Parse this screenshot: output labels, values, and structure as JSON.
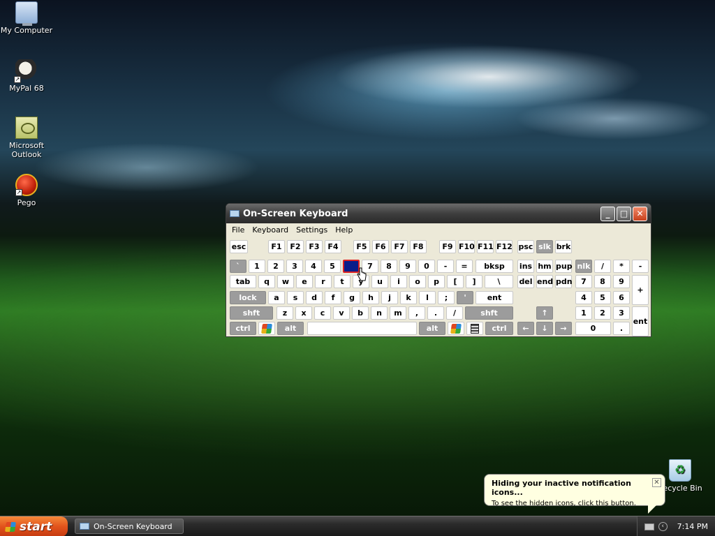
{
  "desktop_icons": [
    {
      "name": "My Computer",
      "icon": "computer-icon"
    },
    {
      "name": "MyPal 68",
      "icon": "mypal-browser-icon"
    },
    {
      "name": "Microsoft Outlook",
      "icon": "outlook-icon"
    },
    {
      "name": "Pego",
      "icon": "pego-icon"
    },
    {
      "name": "Recycle Bin",
      "icon": "recycle-bin-icon"
    }
  ],
  "osk": {
    "title": "On-Screen Keyboard",
    "menu": [
      "File",
      "Keyboard",
      "Settings",
      "Help"
    ],
    "keys": {
      "row0": [
        "esc",
        "F1",
        "F2",
        "F3",
        "F4",
        "F5",
        "F6",
        "F7",
        "F8",
        "F9",
        "F10",
        "F11",
        "F12",
        "psc",
        "slk",
        "brk"
      ],
      "row1": [
        "`",
        "1",
        "2",
        "3",
        "4",
        "5",
        "6",
        "7",
        "8",
        "9",
        "0",
        "-",
        "=",
        "bksp",
        "ins",
        "hm",
        "pup",
        "nlk",
        "/",
        "*",
        "-"
      ],
      "row2": [
        "tab",
        "q",
        "w",
        "e",
        "r",
        "t",
        "y",
        "u",
        "i",
        "o",
        "p",
        "[",
        "]",
        "\\",
        "del",
        "end",
        "pdn",
        "7",
        "8",
        "9",
        "+"
      ],
      "row3": [
        "lock",
        "a",
        "s",
        "d",
        "f",
        "g",
        "h",
        "j",
        "k",
        "l",
        ";",
        "'",
        "ent",
        "4",
        "5",
        "6"
      ],
      "row4": [
        "shft",
        "z",
        "x",
        "c",
        "v",
        "b",
        "n",
        "m",
        ",",
        ".",
        "/",
        "shft",
        "↑",
        "1",
        "2",
        "3",
        "ent"
      ],
      "row5": [
        "ctrl",
        "",
        "alt",
        "",
        "alt",
        "",
        "",
        "ctrl",
        "←",
        "↓",
        "→",
        "0",
        "."
      ]
    },
    "selected_key": "6"
  },
  "balloon": {
    "title": "Hiding your inactive notification icons...",
    "text": "To see the hidden icons, click this button."
  },
  "taskbar": {
    "start_label": "start",
    "tasks": [
      "On-Screen Keyboard"
    ],
    "clock": "7:14 PM"
  }
}
